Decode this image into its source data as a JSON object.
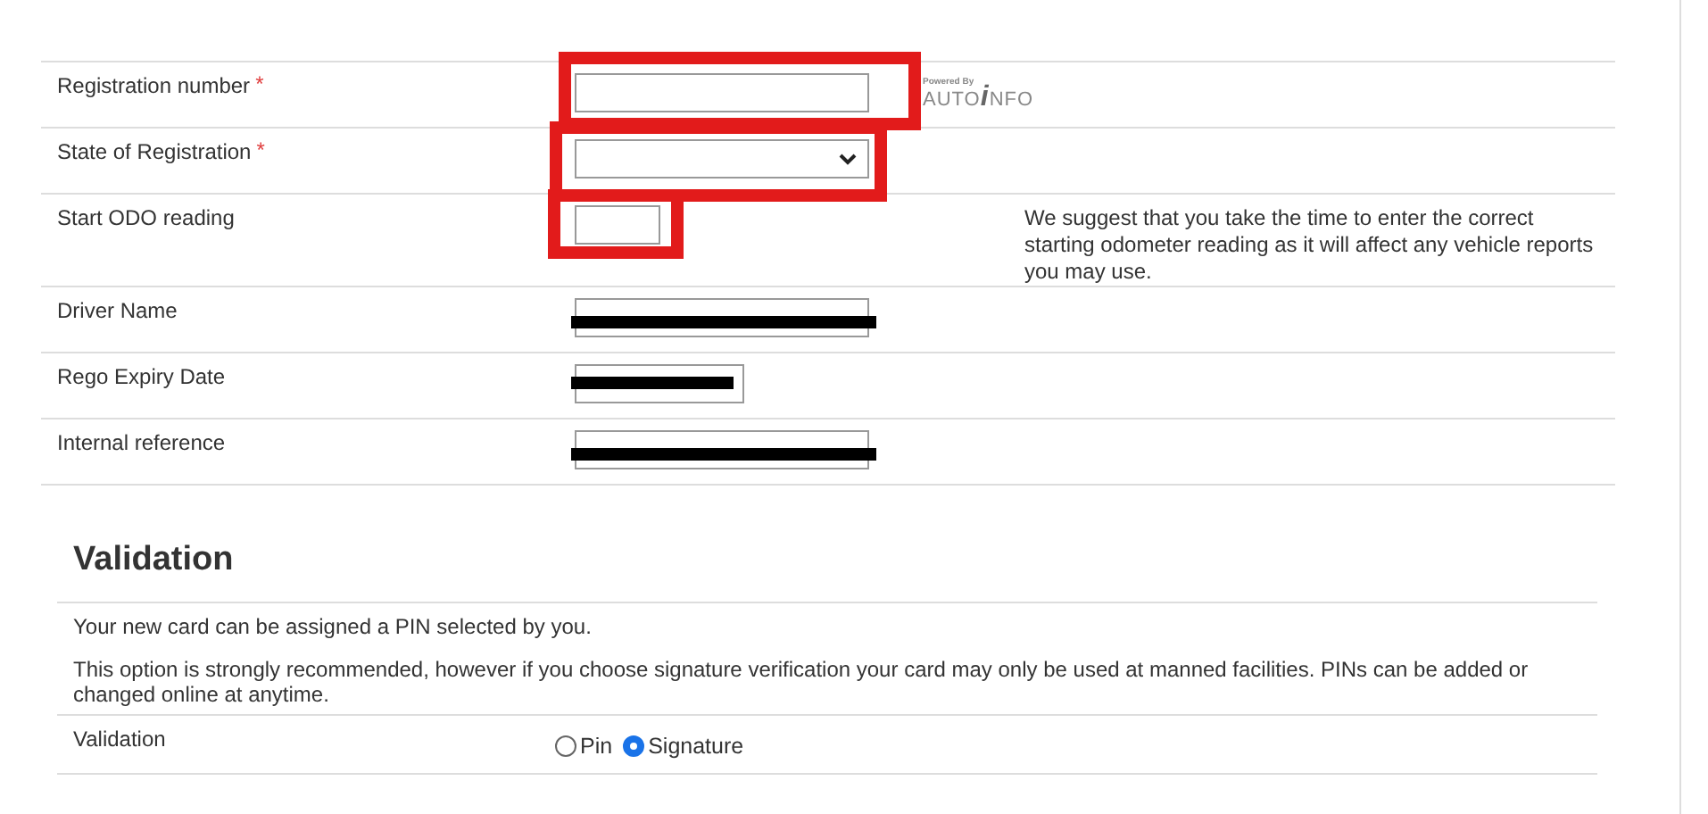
{
  "vehicle_form": {
    "rows": [
      {
        "label": "Registration number",
        "required_mark": "*",
        "field": {
          "kind": "text",
          "annotated": true,
          "redacted": false
        },
        "lookup": {
          "logo_small": "Powered By",
          "logo_name_a": "AUTO",
          "logo_name_b": "i",
          "logo_name_c": "NFO"
        }
      },
      {
        "label": "State of Registration",
        "required_mark": "*",
        "field": {
          "kind": "select",
          "annotated": true,
          "redacted": false
        }
      },
      {
        "label": "Start ODO reading",
        "field": {
          "kind": "odo",
          "annotated": true,
          "redacted": false
        },
        "note": "We suggest that you take the time to enter the correct starting odometer reading as it will affect any vehicle reports you may use."
      },
      {
        "label": "Driver Name",
        "field": {
          "kind": "text",
          "annotated": false,
          "redacted": true
        }
      },
      {
        "label": "Rego Expiry Date",
        "field": {
          "kind": "date",
          "annotated": false,
          "redacted": true
        }
      },
      {
        "label": "Internal reference",
        "field": {
          "kind": "text",
          "annotated": false,
          "redacted": true
        }
      }
    ]
  },
  "validation": {
    "heading": "Validation",
    "intro": "Your new card can be assigned a PIN selected by you.",
    "advice": "This option is strongly recommended, however if you choose signature verification your card may only be used at manned facilities. PINs can be added or changed online at anytime.",
    "label": "Validation",
    "options": [
      {
        "label": "Pin",
        "selected": false
      },
      {
        "label": "Signature",
        "selected": true
      }
    ]
  }
}
